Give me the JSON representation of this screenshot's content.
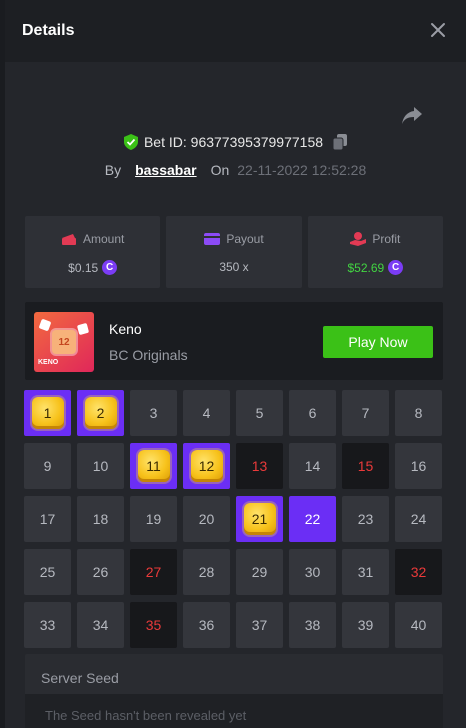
{
  "header": {
    "title": "Details"
  },
  "bet": {
    "id_text": "Bet ID: 96377395379977158",
    "by_label": "By",
    "user": "bassabar",
    "on_label": "On",
    "date": "22-11-2022 12:52:28"
  },
  "stats": {
    "amount": {
      "label": "Amount",
      "value": "$0.15",
      "icon": "wallet-icon"
    },
    "payout": {
      "label": "Payout",
      "value": "350 x",
      "icon": "card-icon"
    },
    "profit": {
      "label": "Profit",
      "value": "$52.69",
      "icon": "hand-coin-icon"
    }
  },
  "coin_symbol": "C",
  "game": {
    "name": "Keno",
    "subtitle": "BC Originals",
    "play_label": "Play Now",
    "thumb_number": "12",
    "thumb_label": "KENO"
  },
  "board": {
    "cells": [
      {
        "n": "1",
        "s": "gem"
      },
      {
        "n": "2",
        "s": "gem"
      },
      {
        "n": "3",
        "s": ""
      },
      {
        "n": "4",
        "s": ""
      },
      {
        "n": "5",
        "s": ""
      },
      {
        "n": "6",
        "s": ""
      },
      {
        "n": "7",
        "s": ""
      },
      {
        "n": "8",
        "s": ""
      },
      {
        "n": "9",
        "s": ""
      },
      {
        "n": "10",
        "s": ""
      },
      {
        "n": "11",
        "s": "gem"
      },
      {
        "n": "12",
        "s": "gem"
      },
      {
        "n": "13",
        "s": "miss"
      },
      {
        "n": "14",
        "s": ""
      },
      {
        "n": "15",
        "s": "miss"
      },
      {
        "n": "16",
        "s": ""
      },
      {
        "n": "17",
        "s": ""
      },
      {
        "n": "18",
        "s": ""
      },
      {
        "n": "19",
        "s": ""
      },
      {
        "n": "20",
        "s": ""
      },
      {
        "n": "21",
        "s": "gem"
      },
      {
        "n": "22",
        "s": "hit"
      },
      {
        "n": "23",
        "s": ""
      },
      {
        "n": "24",
        "s": ""
      },
      {
        "n": "25",
        "s": ""
      },
      {
        "n": "26",
        "s": ""
      },
      {
        "n": "27",
        "s": "miss"
      },
      {
        "n": "28",
        "s": ""
      },
      {
        "n": "29",
        "s": ""
      },
      {
        "n": "30",
        "s": ""
      },
      {
        "n": "31",
        "s": ""
      },
      {
        "n": "32",
        "s": "miss"
      },
      {
        "n": "33",
        "s": ""
      },
      {
        "n": "34",
        "s": ""
      },
      {
        "n": "35",
        "s": "miss"
      },
      {
        "n": "36",
        "s": ""
      },
      {
        "n": "37",
        "s": ""
      },
      {
        "n": "38",
        "s": ""
      },
      {
        "n": "39",
        "s": ""
      },
      {
        "n": "40",
        "s": ""
      }
    ]
  },
  "seed": {
    "title": "Server Seed",
    "text": "The Seed hasn't been revealed yet"
  },
  "colors": {
    "accent": "#6b2ef5",
    "play": "#3bc117",
    "profit": "#42d442",
    "miss": "#ea3a3a"
  }
}
